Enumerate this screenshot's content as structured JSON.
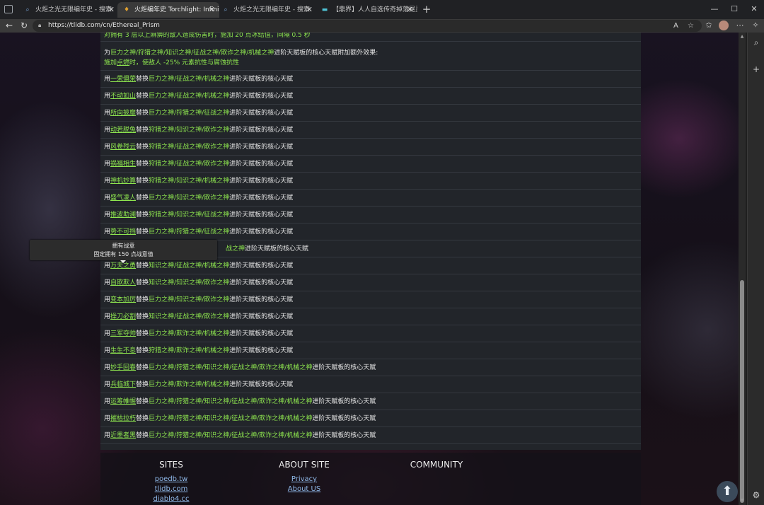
{
  "browser": {
    "tabs": [
      {
        "title": "火炬之光无限编年史 - 搜索",
        "icon": "search-icon",
        "active": false
      },
      {
        "title": "火炬编年史 Torchlight: Infinite W",
        "icon": "ember-icon",
        "active": true
      },
      {
        "title": "火炬之光无限编年史 - 搜索",
        "icon": "search-icon",
        "active": false
      },
      {
        "title": "【鼎界】人人自选传奇掉落晃灵!",
        "icon": "tv-icon",
        "active": false
      }
    ],
    "url": "https://tlidb.com/cn/Ethereal_Prism"
  },
  "page": {
    "top_partial": "对拥有 3 层以上麻痹的敌人造成伤害时，施加 20 点冰结值，间隔 0.5 秒",
    "extra_effect": {
      "prefix": "为",
      "gods": "巨力之神/狩猎之神/知识之神/征战之神/欺诈之神/机械之神",
      "suffix": "进阶天赋板的核心天赋附加额外效果:",
      "line2_pre": "施加",
      "line2_link": "点燃",
      "line2_post": "时，使敌人 -25% 元素抗性与腐蚀抗性"
    },
    "rows": [
      {
        "link": "一荣俱荣",
        "gods": "巨力之神/征战之神/机械之神"
      },
      {
        "link": "不动如山",
        "gods": "巨力之神/征战之神/机械之神"
      },
      {
        "link": "所向披靡",
        "gods": "巨力之神/狩猎之神/征战之神"
      },
      {
        "link": "动若脱兔",
        "gods": "狩猎之神/知识之神/欺诈之神"
      },
      {
        "link": "风卷残云",
        "gods": "狩猎之神/征战之神/欺诈之神"
      },
      {
        "link": "祸福相生",
        "gods": "狩猎之神/征战之神/欺诈之神"
      },
      {
        "link": "神机妙算",
        "gods": "狩猎之神/知识之神/机械之神"
      },
      {
        "link": "盛气凌人",
        "gods": "巨力之神/知识之神/欺诈之神"
      },
      {
        "link": "推波助澜",
        "gods": "狩猎之神/知识之神/征战之神"
      },
      {
        "link": "势不可挡",
        "gods": "巨力之神/狩猎之神/征战之神"
      },
      {
        "link": "",
        "gods": "战之神",
        "partial": true
      },
      {
        "link": "万夫之勇",
        "gods": "知识之神/征战之神/机械之神"
      },
      {
        "link": "自欺欺人",
        "gods": "知识之神/知识之神/欺诈之神"
      },
      {
        "link": "变本加厉",
        "gods": "巨力之神/知识之神/欺诈之神"
      },
      {
        "link": "操刀必割",
        "gods": "知识之神/征战之神/欺诈之神"
      },
      {
        "link": "三军夺帅",
        "gods": "巨力之神/欺诈之神/机械之神"
      },
      {
        "link": "生生不息",
        "gods": "狩猎之神/欺诈之神/机械之神"
      },
      {
        "link": "妙手回春",
        "gods": "巨力之神/狩猎之神/知识之神/征战之神/欺诈之神/机械之神"
      },
      {
        "link": "兵临城下",
        "gods": "巨力之神/欺诈之神/机械之神"
      },
      {
        "link": "运筹帷幄",
        "gods": "巨力之神/狩猎之神/知识之神/征战之神/欺诈之神/机械之神"
      },
      {
        "link": "摧枯拉朽",
        "gods": "巨力之神/狩猎之神/知识之神/征战之神/欺诈之神/机械之神"
      },
      {
        "link": "近墨者黑",
        "gods": "巨力之神/狩猎之神/知识之神/征战之神/欺诈之神/机械之神"
      }
    ],
    "row_prefix": "用",
    "row_mid": "替换",
    "row_suffix": "进阶天赋板的核心天赋",
    "tooltip": {
      "title": "拥有战意",
      "body": "固定拥有 150 点战意值"
    }
  },
  "footer": {
    "sites_title": "SITES",
    "about_title": "ABOUT SITE",
    "community_title": "COMMUNITY",
    "sites": [
      "poedb.tw",
      "tlidb.com",
      "diablo4.cc"
    ],
    "about": [
      "Privacy",
      "About US"
    ]
  },
  "colors": {
    "accent_green": "#8ee64f",
    "link_blue": "#8fb8e8",
    "panel": "#22252a"
  }
}
